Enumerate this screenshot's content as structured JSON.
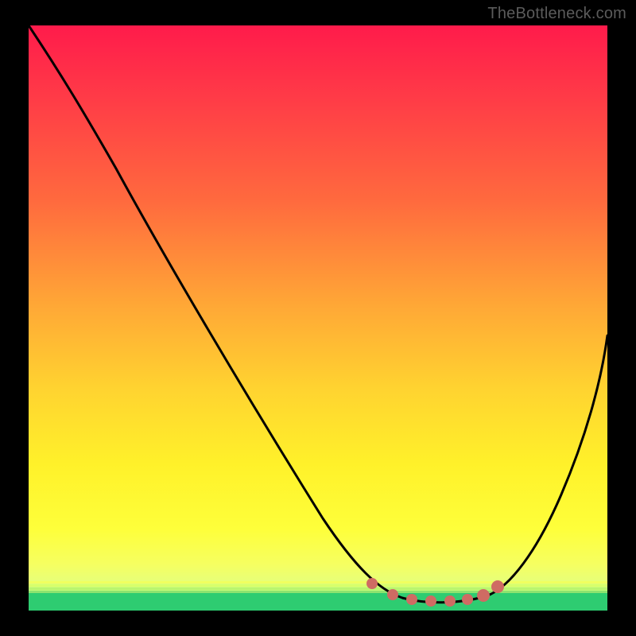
{
  "watermark": "TheBottleneck.com",
  "chart_data": {
    "type": "line",
    "title": "",
    "xlabel": "",
    "ylabel": "",
    "xlim": [
      0,
      100
    ],
    "ylim": [
      0,
      100
    ],
    "series": [
      {
        "name": "bottleneck-curve",
        "x": [
          0,
          5,
          12,
          20,
          28,
          36,
          44,
          52,
          58,
          62,
          65,
          68,
          72,
          76,
          80,
          84,
          88,
          92,
          96,
          100
        ],
        "values": [
          100,
          94,
          84,
          72,
          60,
          48,
          36,
          24,
          14,
          7,
          3,
          1,
          1,
          1,
          3,
          8,
          16,
          26,
          38,
          52
        ]
      }
    ],
    "markers": {
      "name": "highlight-dots",
      "x": [
        60,
        64,
        67,
        70,
        73,
        76,
        79,
        82
      ],
      "values": [
        5,
        2,
        1,
        1,
        1,
        1,
        2,
        4
      ],
      "color": "#cf6b63"
    },
    "gradient_stops": [
      {
        "pos": 0,
        "color": "#ff1b4b"
      },
      {
        "pos": 12,
        "color": "#ff3a47"
      },
      {
        "pos": 30,
        "color": "#ff6a3e"
      },
      {
        "pos": 48,
        "color": "#ffa836"
      },
      {
        "pos": 62,
        "color": "#ffd330"
      },
      {
        "pos": 75,
        "color": "#fff12a"
      },
      {
        "pos": 86,
        "color": "#feff3a"
      },
      {
        "pos": 92,
        "color": "#f6ff60"
      },
      {
        "pos": 95,
        "color": "#e7ff78"
      },
      {
        "pos": 98,
        "color": "#9cf77a"
      },
      {
        "pos": 100,
        "color": "#2ecc71"
      }
    ]
  }
}
